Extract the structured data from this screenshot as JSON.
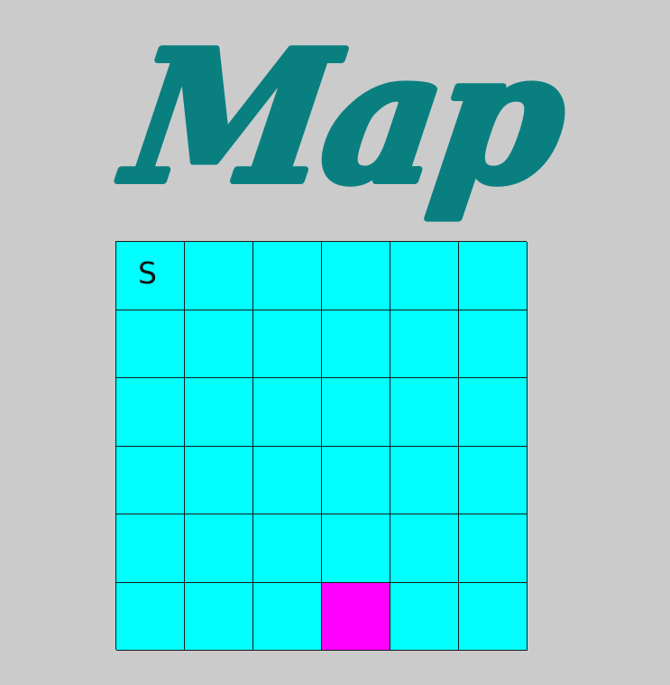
{
  "title": "Map",
  "colors": {
    "background": "#cbcbcb",
    "title": "#0a7f80",
    "cell": "#00ffff",
    "target": "#ff00ff",
    "gridline": "#1a1a1a"
  },
  "grid": {
    "rows": 6,
    "cols": 6,
    "start": {
      "row": 0,
      "col": 0,
      "label": "S"
    },
    "target": {
      "row": 5,
      "col": 3
    }
  }
}
